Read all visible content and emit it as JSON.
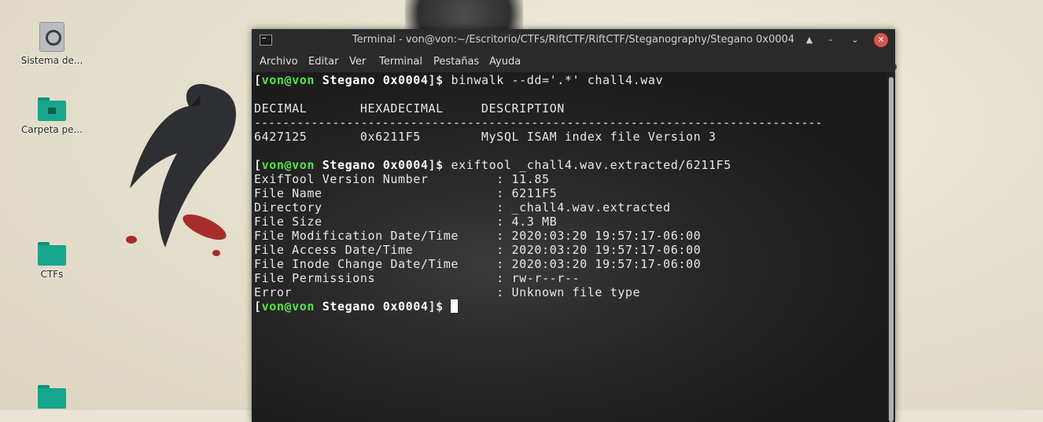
{
  "desktop": {
    "icons": [
      {
        "label": "Sistema de...",
        "icon": "disk-icon"
      },
      {
        "label": "Carpeta pe...",
        "icon": "home-folder-icon"
      },
      {
        "label": "CTFs",
        "icon": "folder-icon"
      }
    ]
  },
  "window": {
    "title": "Terminal - von@von:~/Escritorio/CTFs/RiftCTF/RiftCTF/Steganography/Stegano 0x0004",
    "buttons": {
      "shade": "▲",
      "minimize": "–",
      "maximize": "⌄",
      "close": "✕"
    }
  },
  "menu": [
    "Archivo",
    "Editar",
    "Ver",
    "Terminal",
    "Pestañas",
    "Ayuda"
  ],
  "prompt": {
    "open": "[",
    "user": "von@von",
    "dir": " Stegano 0x0004",
    "close": "]$ "
  },
  "terminal": {
    "cmd1": "binwalk --dd='.*' chall4.wav",
    "binwalk_header": "DECIMAL       HEXADECIMAL     DESCRIPTION",
    "binwalk_rule": "--------------------------------------------------------------------------------",
    "binwalk_row": "6427125       0x6211F5        MySQL ISAM index file Version 3",
    "cmd2": "exiftool _chall4.wav.extracted/6211F5",
    "exif": [
      "ExifTool Version Number         : 11.85",
      "File Name                       : 6211F5",
      "Directory                       : _chall4.wav.extracted",
      "File Size                       : 4.3 MB",
      "File Modification Date/Time     : 2020:03:20 19:57:17-06:00",
      "File Access Date/Time           : 2020:03:20 19:57:17-06:00",
      "File Inode Change Date/Time     : 2020:03:20 19:57:17-06:00",
      "File Permissions                : rw-r--r--",
      "Error                           : Unknown file type"
    ]
  }
}
